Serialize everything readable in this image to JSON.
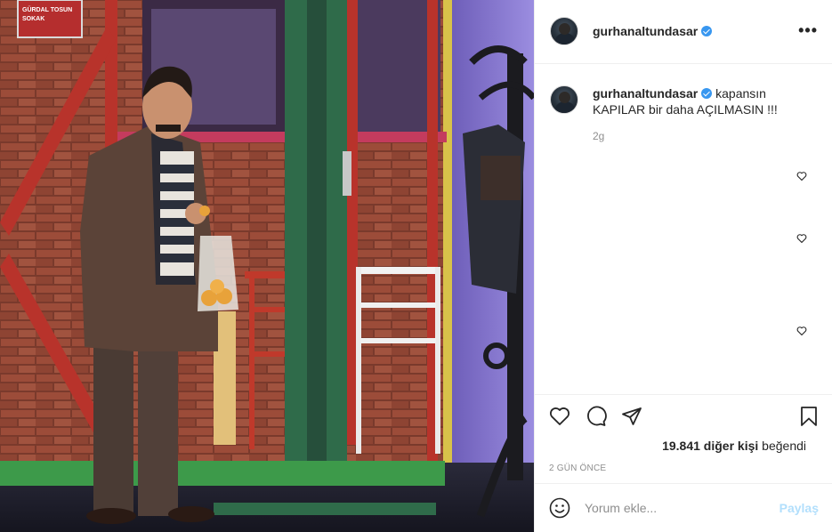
{
  "post": {
    "username": "gurhanaltundasar",
    "verified": true,
    "more_icon": "more-horizontal-icon",
    "caption_user": "gurhanaltundasar",
    "caption_line1": "kapansın",
    "caption_line2": "KAPILAR bir daha AÇILMASIN !!!",
    "caption_time": "2g",
    "likes_count": "19.841 diğer kişi",
    "likes_suffix": "beğendi",
    "date_label": "2 GÜN ÖNCE",
    "comment_placeholder": "Yorum ekle...",
    "share_label": "Paylaş"
  },
  "photo": {
    "street_sign_line1": "GÜRDAL TOSUN",
    "street_sign_line2": "SOKAK"
  },
  "icons": {
    "like": "heart-icon",
    "comment": "comment-icon",
    "share": "paper-plane-icon",
    "save": "bookmark-icon",
    "emoji": "smiley-icon",
    "verified": "verified-badge-icon"
  },
  "colors": {
    "accent_blue": "#3897f0",
    "share_disabled": "#b2dffc",
    "meta_gray": "#8e8e8e",
    "text": "#262626"
  }
}
